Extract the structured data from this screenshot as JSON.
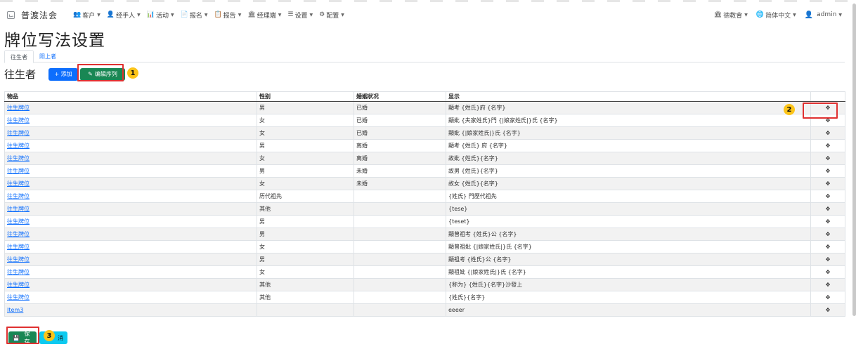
{
  "navbar": {
    "brand": "普渡法会",
    "menu": [
      {
        "icon": "users-icon",
        "glyph": "👥",
        "label": "客户"
      },
      {
        "icon": "user-icon",
        "glyph": "👤",
        "label": "经手人"
      },
      {
        "icon": "chart-icon",
        "glyph": "📊",
        "label": "活动"
      },
      {
        "icon": "file-icon",
        "glyph": "📄",
        "label": "报名"
      },
      {
        "icon": "report-icon",
        "glyph": "📋",
        "label": "报告"
      },
      {
        "icon": "bank-icon",
        "glyph": "🏛",
        "label": "经理端"
      },
      {
        "icon": "list-icon",
        "glyph": "☰",
        "label": "设置"
      },
      {
        "icon": "gear-icon",
        "glyph": "⚙",
        "label": "配置"
      }
    ],
    "right": {
      "org": "德教會",
      "language": "简体中文",
      "user": "admin"
    }
  },
  "page": {
    "title": "牌位写法设置",
    "tabs": [
      {
        "label": "往生者",
        "active": true
      },
      {
        "label": "阳上者",
        "active": false
      }
    ],
    "section_title": "往生者",
    "add_label": "+ 添加",
    "edit_order_label": "编辑序列",
    "save_label": "保存",
    "cancel_label": "消"
  },
  "annotations": [
    "1",
    "2",
    "3"
  ],
  "table": {
    "columns": [
      "物品",
      "性别",
      "婚姻状况",
      "显示",
      ""
    ],
    "rows": [
      {
        "item": "往生牌位",
        "gender": "男",
        "marital": "已婚",
        "display": "顯考 {姓氏}府 {名字}"
      },
      {
        "item": "往生牌位",
        "gender": "女",
        "marital": "已婚",
        "display": "顯妣 {夫家姓氏}門 {|娘家姓氏|}氏 {名字}"
      },
      {
        "item": "往生牌位",
        "gender": "女",
        "marital": "已婚",
        "display": "顯妣 {|娘家姓氏|}氏 {名字}"
      },
      {
        "item": "往生牌位",
        "gender": "男",
        "marital": "离婚",
        "display": "顯考 {姓氏} 府 {名字}"
      },
      {
        "item": "往生牌位",
        "gender": "女",
        "marital": "离婚",
        "display": "故妣 {姓氏}{名字}"
      },
      {
        "item": "往生牌位",
        "gender": "男",
        "marital": "未婚",
        "display": "故男 {姓氏}{名字}"
      },
      {
        "item": "往生牌位",
        "gender": "女",
        "marital": "未婚",
        "display": "故女 {姓氏}{名字}"
      },
      {
        "item": "往生牌位",
        "gender": "历代祖先",
        "marital": "",
        "display": "{姓氏} 門歷代祖先"
      },
      {
        "item": "往生牌位",
        "gender": "其他",
        "marital": "",
        "display": "{tese}"
      },
      {
        "item": "往生牌位",
        "gender": "男",
        "marital": "",
        "display": "{teset}"
      },
      {
        "item": "往生牌位",
        "gender": "男",
        "marital": "",
        "display": "顯曾祖考 {姓氏}公 {名字}"
      },
      {
        "item": "往生牌位",
        "gender": "女",
        "marital": "",
        "display": "顯曾祖妣 {|娘家姓氏|}氏 {名字}"
      },
      {
        "item": "往生牌位",
        "gender": "男",
        "marital": "",
        "display": "顯祖考 {姓氏}公 {名字}"
      },
      {
        "item": "往生牌位",
        "gender": "女",
        "marital": "",
        "display": "顯祖妣 {|娘家姓氏|}氏 {名字}"
      },
      {
        "item": "往生牌位",
        "gender": "其他",
        "marital": "",
        "display": "{称为} {姓氏}{名字}沙發上"
      },
      {
        "item": "往生牌位",
        "gender": "其他",
        "marital": "",
        "display": "{姓氏}{名字}"
      },
      {
        "item": "Item3",
        "gender": "",
        "marital": "",
        "display": "eeeer"
      }
    ],
    "move_glyph": "✥"
  }
}
